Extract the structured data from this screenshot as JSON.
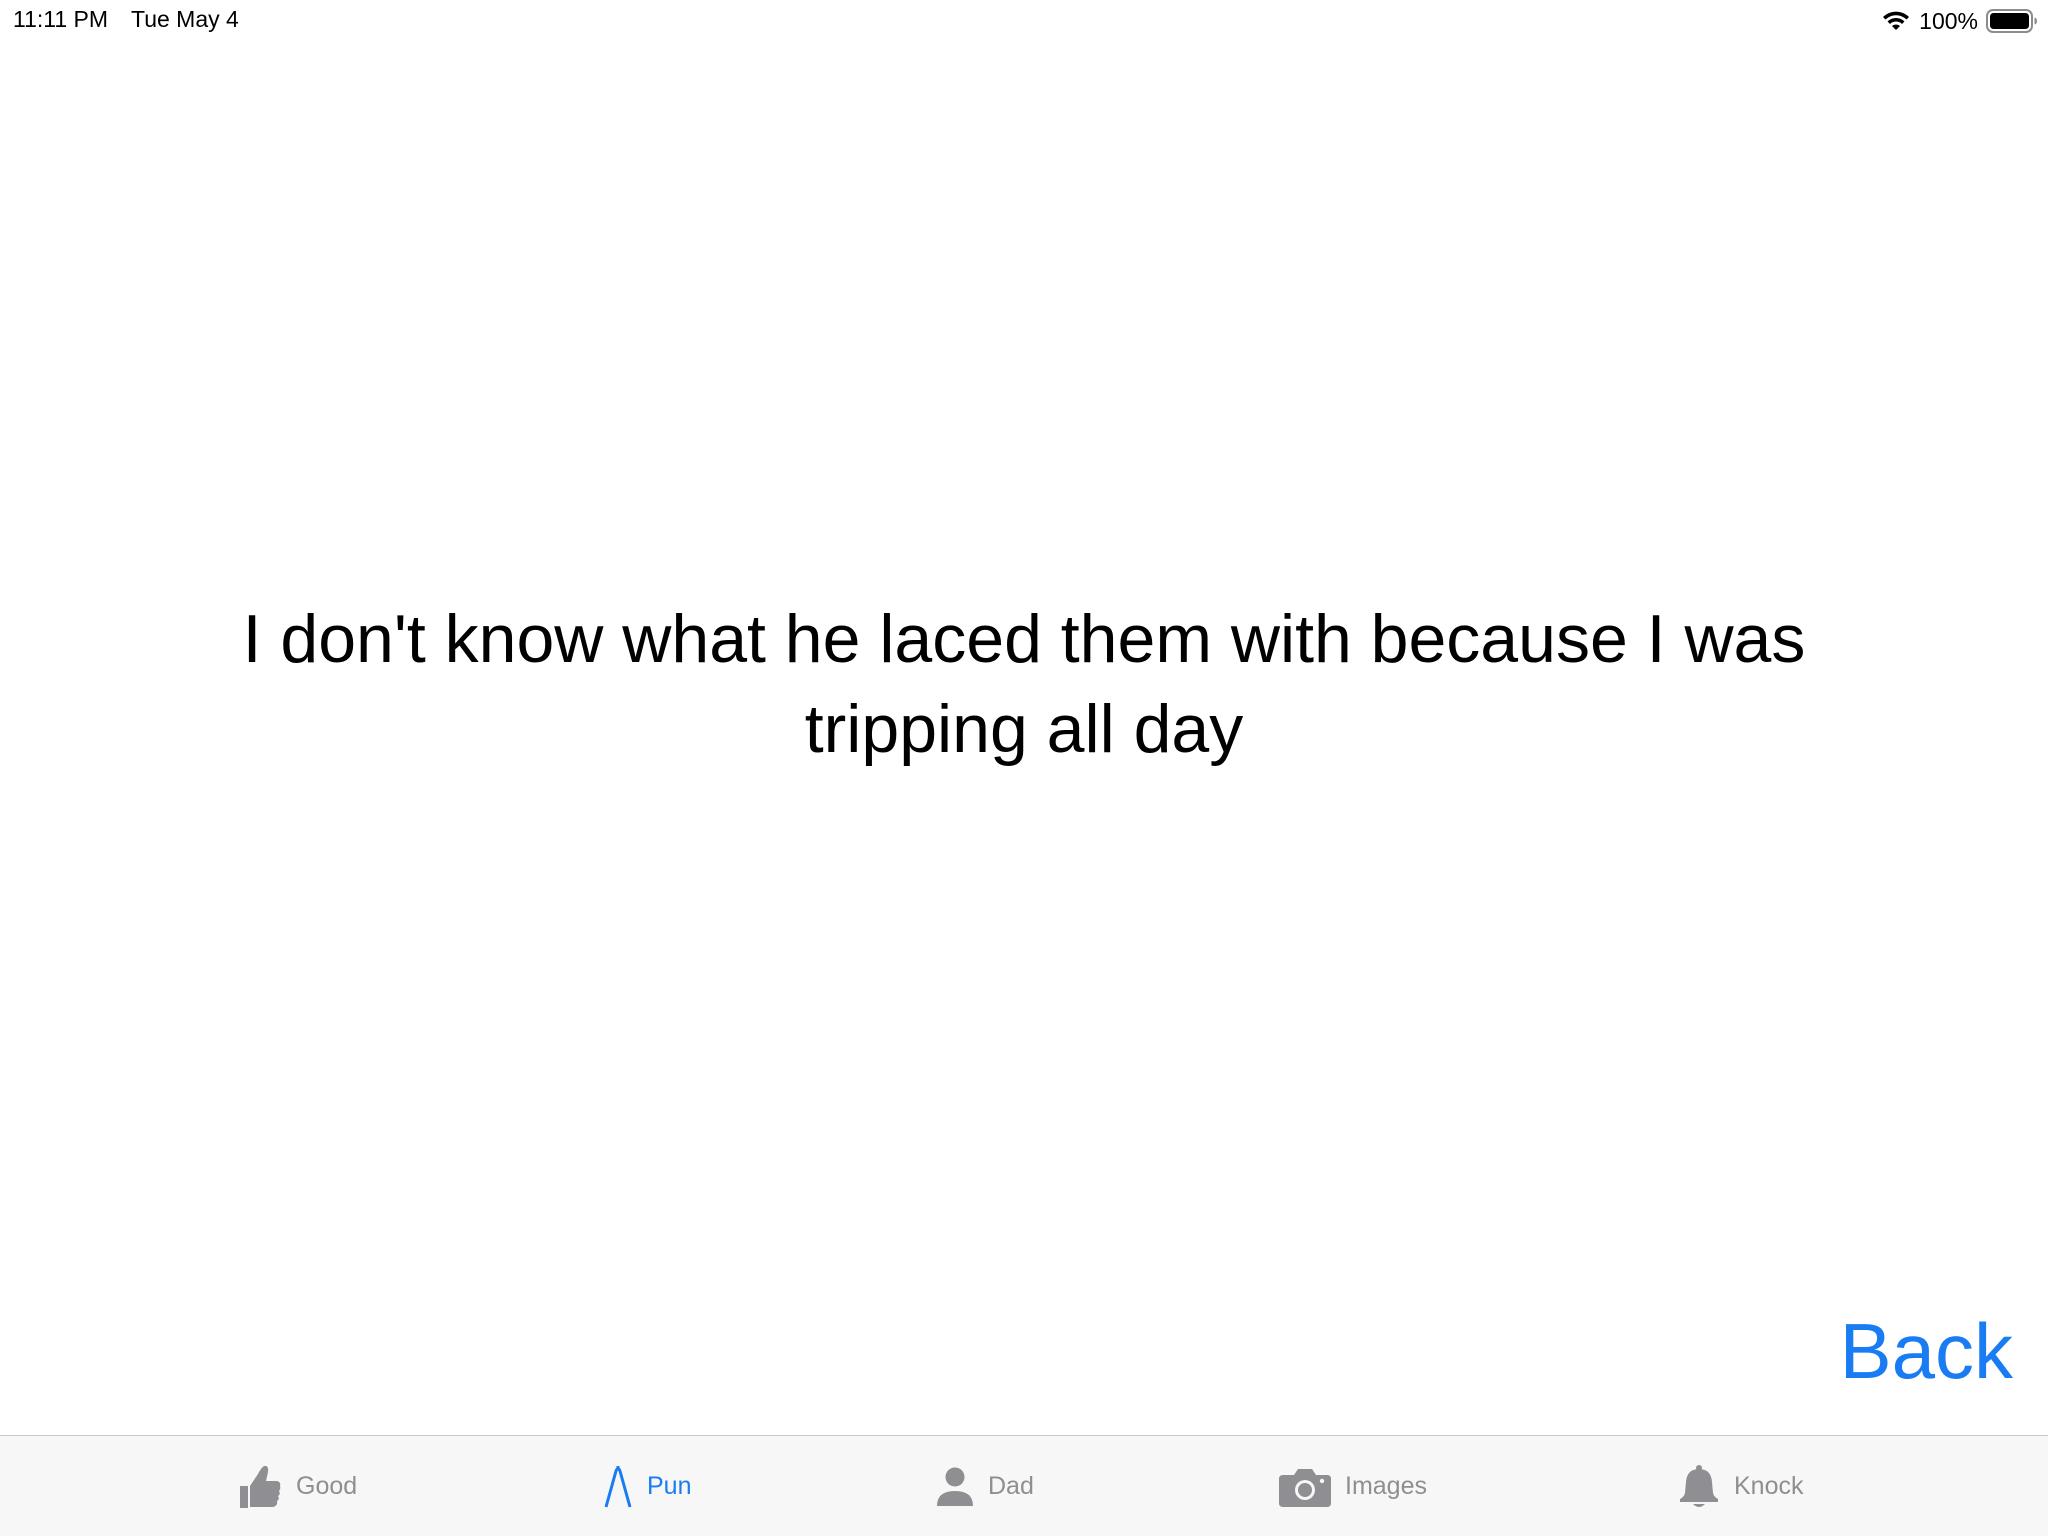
{
  "status_bar": {
    "time": "11:11 PM",
    "date": "Tue May 4",
    "battery_percent": "100%",
    "battery_level": 1.0
  },
  "joke": {
    "text": "I don't know what he laced them with because I was tripping all day"
  },
  "navigation": {
    "back_label": "Back"
  },
  "tab_bar": {
    "active_index": 1,
    "tabs": [
      {
        "label": "Good",
        "icon": "thumbs-up-icon"
      },
      {
        "label": "Pun",
        "icon": "compass-a-icon"
      },
      {
        "label": "Dad",
        "icon": "person-icon"
      },
      {
        "label": "Images",
        "icon": "camera-icon"
      },
      {
        "label": "Knock",
        "icon": "bell-icon"
      }
    ]
  },
  "colors": {
    "accent": "#1a7cf2",
    "inactive": "#8e8e93",
    "tab_bar_bg": "#f7f7f7"
  }
}
